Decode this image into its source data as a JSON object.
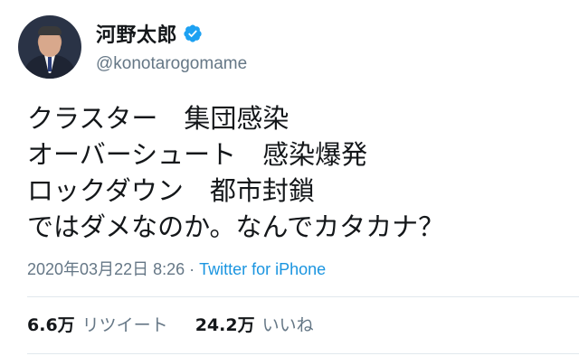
{
  "author": {
    "display_name": "河野太郎",
    "handle": "@konotarogomame",
    "verified": true
  },
  "tweet": {
    "lines": [
      "クラスター　集団感染",
      "オーバーシュート　感染爆発",
      "ロックダウン　都市封鎖",
      "ではダメなのか。なんでカタカナ？"
    ],
    "timestamp": "2020年03月22日 8:26",
    "separator": " · ",
    "source": "Twitter for iPhone"
  },
  "stats": {
    "retweets_count": "6.6万",
    "retweets_label": "リツイート",
    "likes_count": "24.2万",
    "likes_label": "いいね"
  },
  "colors": {
    "verified_blue": "#1da1f2",
    "link_blue": "#1b95e0",
    "secondary_text": "#657786",
    "primary_text": "#14171a"
  }
}
